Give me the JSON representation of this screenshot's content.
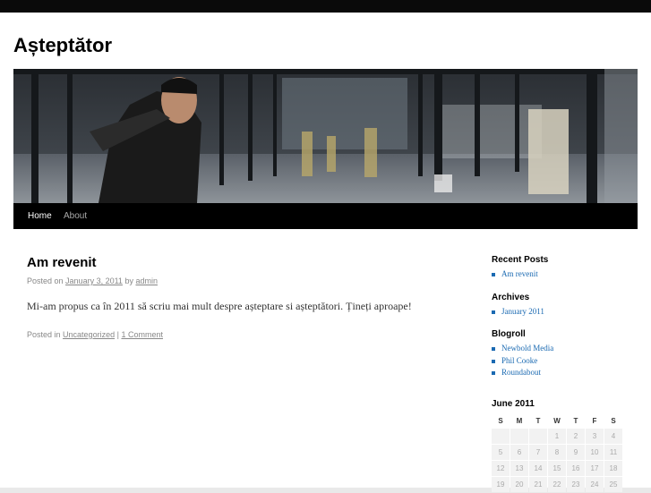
{
  "site": {
    "title": "Așteptător"
  },
  "nav": {
    "home": "Home",
    "about": "About"
  },
  "post": {
    "title": "Am revenit",
    "meta_prefix": "Posted on",
    "date": "January 3, 2011",
    "by": "by",
    "author": "admin",
    "content": "Mi-am propus ca în 2011 să scriu mai mult despre așteptare si așteptători. Țineți aproape!",
    "posted_in": "Posted in",
    "category": "Uncategorized",
    "separator": "|",
    "comments": "1 Comment"
  },
  "sidebar": {
    "recent_title": "Recent Posts",
    "recent": [
      "Am revenit"
    ],
    "archives_title": "Archives",
    "archives": [
      "January 2011"
    ],
    "blogroll_title": "Blogroll",
    "blogroll": [
      "Newbold Media",
      "Phil Cooke",
      "Roundabout"
    ]
  },
  "calendar": {
    "caption": "June 2011",
    "days": [
      "S",
      "M",
      "T",
      "W",
      "T",
      "F",
      "S"
    ],
    "rows": [
      [
        "",
        "",
        "",
        "1",
        "2",
        "3",
        "4"
      ],
      [
        "5",
        "6",
        "7",
        "8",
        "9",
        "10",
        "11"
      ],
      [
        "12",
        "13",
        "14",
        "15",
        "16",
        "17",
        "18"
      ],
      [
        "19",
        "20",
        "21",
        "22",
        "23",
        "24",
        "25"
      ]
    ]
  },
  "colors": {
    "link": "#1b6ab2",
    "nav_bg": "#000000",
    "top_bar": "#0a0a0a"
  },
  "icons": {
    "list_bullet": "square-bullet-icon"
  }
}
